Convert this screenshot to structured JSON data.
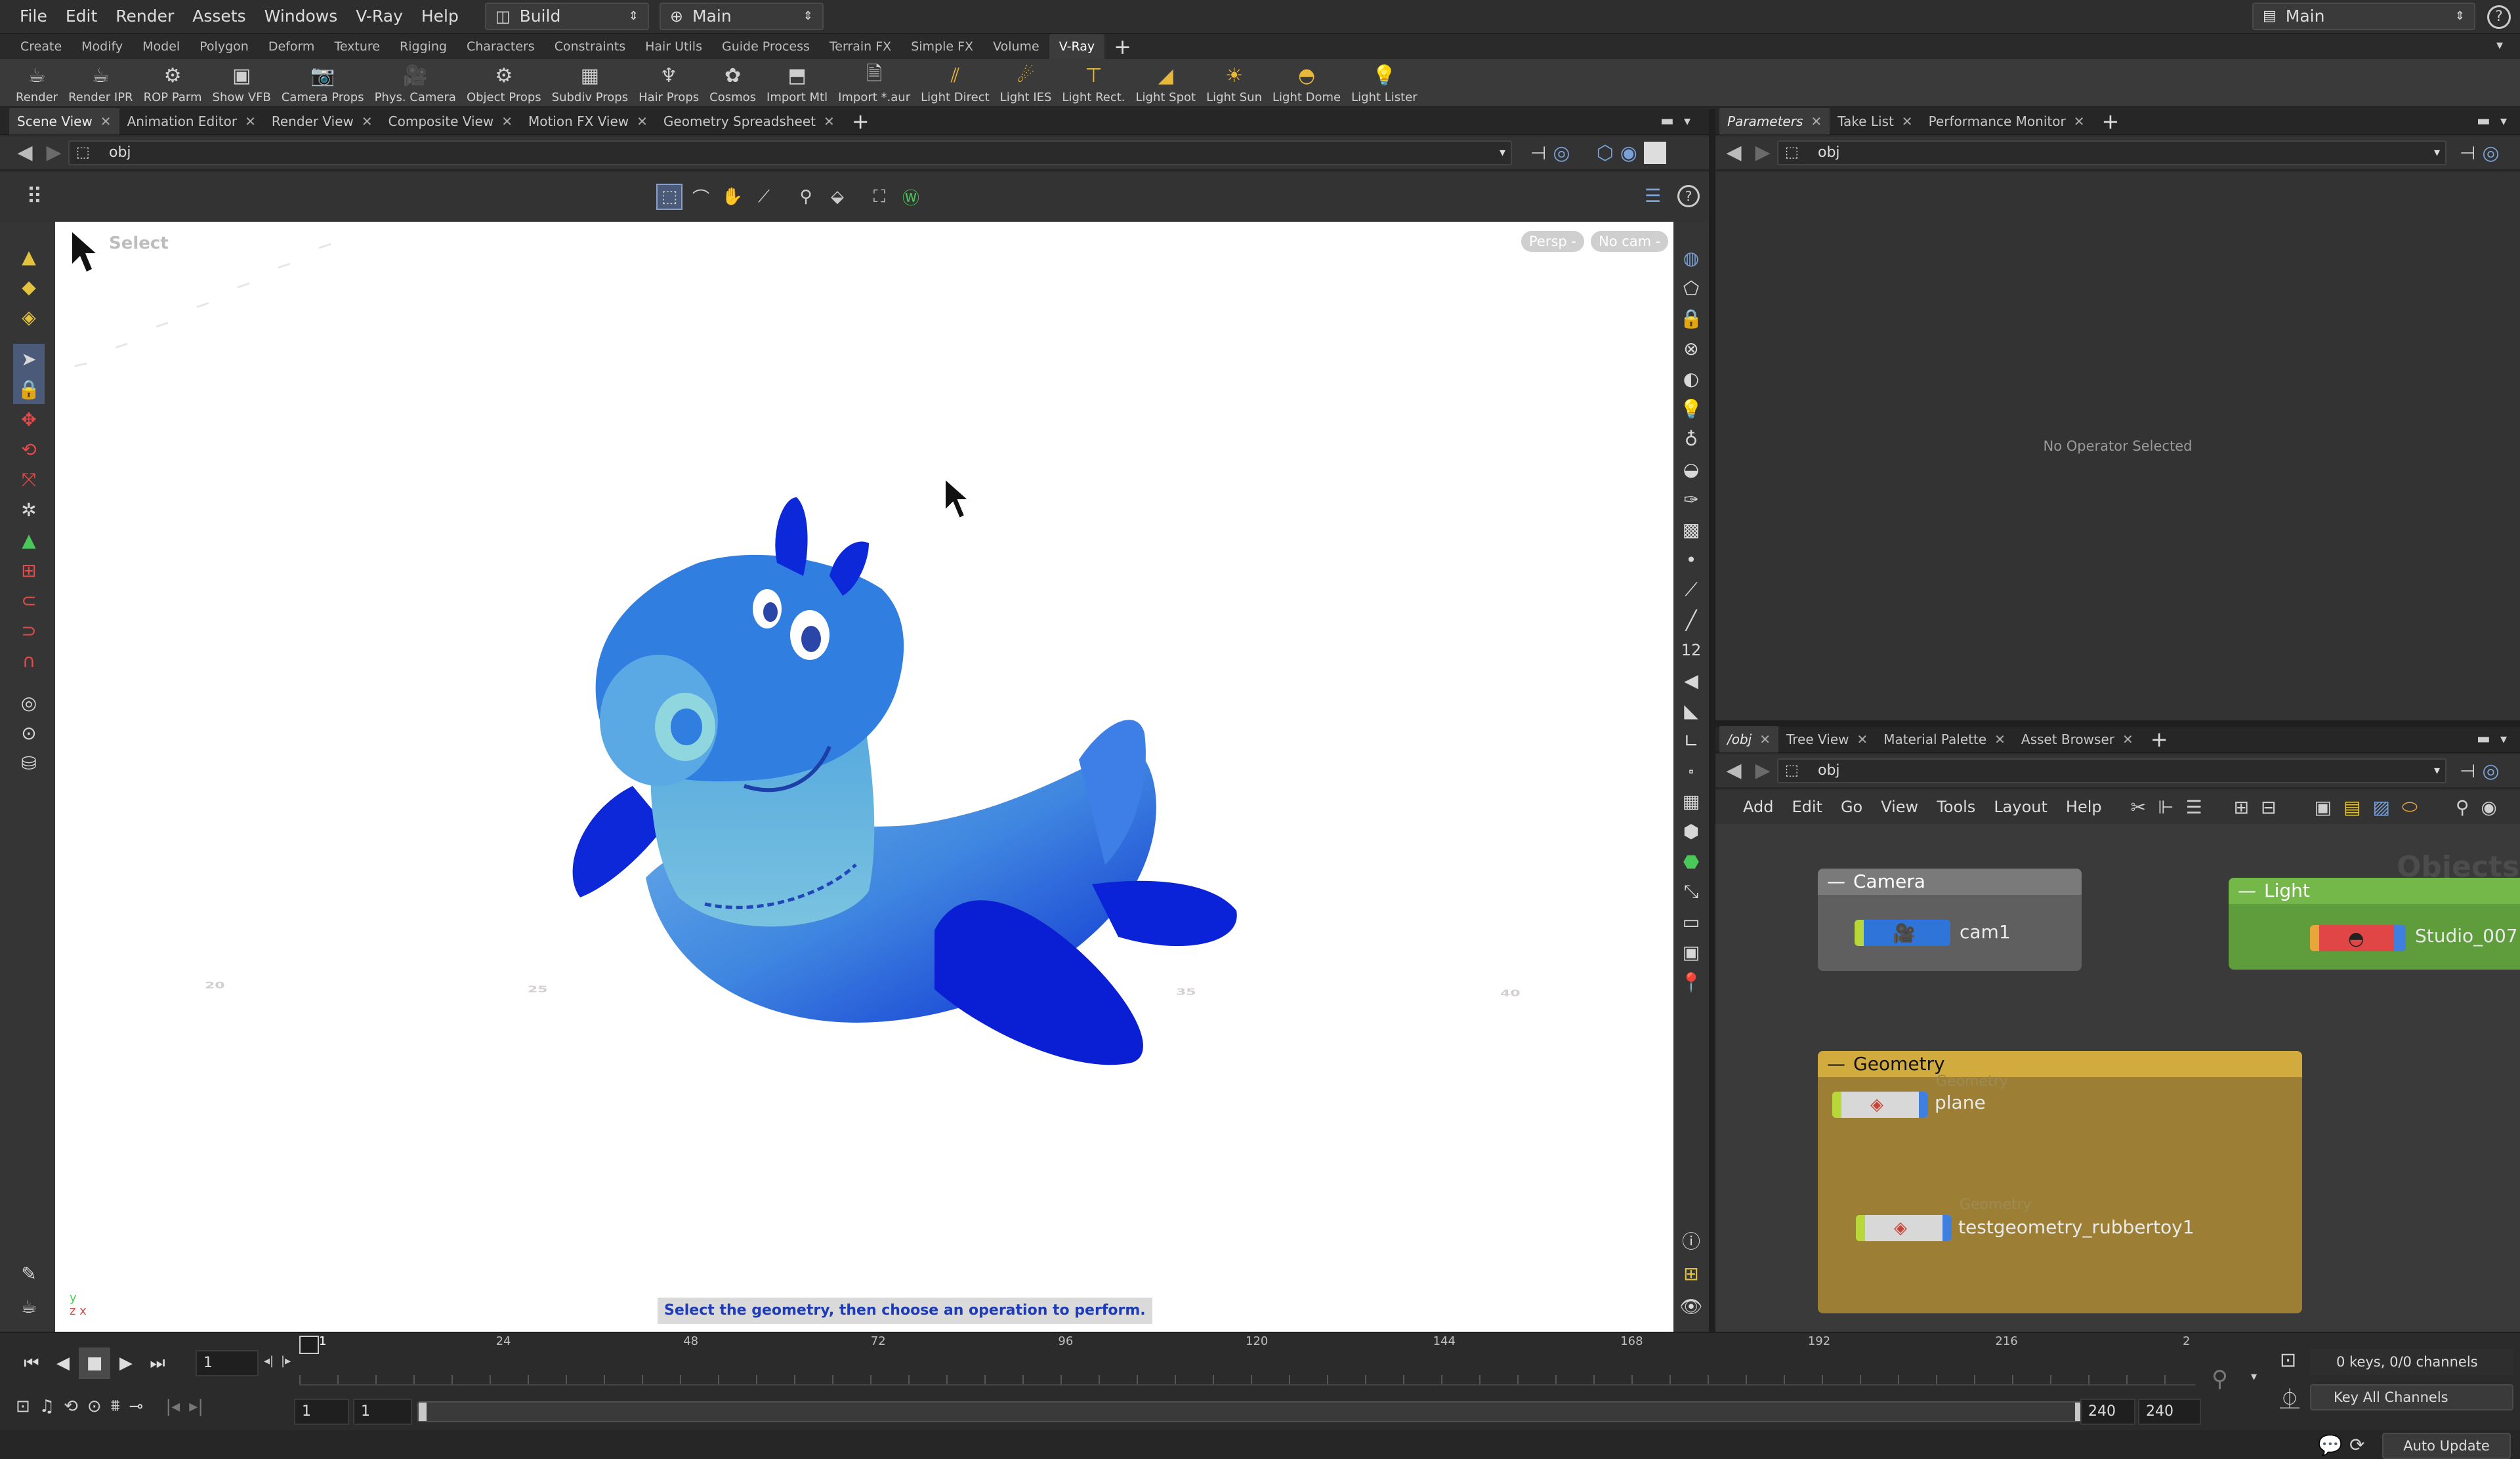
{
  "menu": [
    "File",
    "Edit",
    "Render",
    "Assets",
    "Windows",
    "V-Ray",
    "Help"
  ],
  "desktop": {
    "build_label": "Build",
    "main_label": "Main",
    "right_main_label": "Main"
  },
  "shelf_tabs": [
    "Create",
    "Modify",
    "Model",
    "Polygon",
    "Deform",
    "Texture",
    "Rigging",
    "Characters",
    "Constraints",
    "Hair Utils",
    "Guide Process",
    "Terrain FX",
    "Simple FX",
    "Volume",
    "V-Ray"
  ],
  "shelf_active": "V-Ray",
  "shelf_tools": [
    {
      "label": "Render",
      "icon": "teapot-icon",
      "glyph": "☕"
    },
    {
      "label": "Render IPR",
      "icon": "teapot-ipr-icon",
      "glyph": "☕"
    },
    {
      "label": "ROP Parm",
      "icon": "gear-icon",
      "glyph": "⚙"
    },
    {
      "label": "Show VFB",
      "icon": "frame-buffer-icon",
      "glyph": "▣"
    },
    {
      "label": "Camera Props",
      "icon": "camera-icon",
      "glyph": "📷"
    },
    {
      "label": "Phys. Camera",
      "icon": "physical-camera-icon",
      "glyph": "🎥"
    },
    {
      "label": "Object Props",
      "icon": "object-gear-icon",
      "glyph": "⚙"
    },
    {
      "label": "Subdiv Props",
      "icon": "subdiv-icon",
      "glyph": "▦"
    },
    {
      "label": "Hair Props",
      "icon": "hair-icon",
      "glyph": "♆"
    },
    {
      "label": "Cosmos",
      "icon": "cosmos-icon",
      "glyph": "✿"
    },
    {
      "label": "Import Mtl",
      "icon": "import-material-icon",
      "glyph": "⬒"
    },
    {
      "label": "Import *.aur",
      "icon": "import-aur-icon",
      "glyph": "🗎"
    },
    {
      "label": "Light Direct",
      "icon": "light-direct-icon",
      "glyph": "⫽"
    },
    {
      "label": "Light IES",
      "icon": "light-ies-icon",
      "glyph": "☄"
    },
    {
      "label": "Light Rect.",
      "icon": "light-rect-icon",
      "glyph": "⊤"
    },
    {
      "label": "Light Spot",
      "icon": "light-spot-icon",
      "glyph": "◢"
    },
    {
      "label": "Light Sun",
      "icon": "light-sun-icon",
      "glyph": "☀"
    },
    {
      "label": "Light Dome",
      "icon": "light-dome-icon",
      "glyph": "◓"
    },
    {
      "label": "Light Lister",
      "icon": "light-lister-icon",
      "glyph": "💡"
    }
  ],
  "left_tabs": [
    {
      "label": "Scene View",
      "active": true
    },
    {
      "label": "Animation Editor",
      "active": false
    },
    {
      "label": "Render View",
      "active": false
    },
    {
      "label": "Composite View",
      "active": false
    },
    {
      "label": "Motion FX View",
      "active": false
    },
    {
      "label": "Geometry Spreadsheet",
      "active": false
    }
  ],
  "path": "obj",
  "viewport": {
    "mode_label": "Select",
    "persp_label": "Persp -",
    "cam_label": "No cam -",
    "hint": "Select the geometry, then choose an operation to perform.",
    "grid_labels": [
      "20",
      "25",
      "35",
      "40"
    ],
    "axis_y": "y",
    "axis_zx": "z x",
    "model_color": "#1f5fe0"
  },
  "right_top_tabs": [
    {
      "label": "Parameters",
      "active": true
    },
    {
      "label": "Take List",
      "active": false
    },
    {
      "label": "Performance Monitor",
      "active": false
    }
  ],
  "params_empty": "No Operator Selected",
  "right_bottom_tabs": [
    {
      "label": "/obj",
      "active": true
    },
    {
      "label": "Tree View",
      "active": false
    },
    {
      "label": "Material Palette",
      "active": false
    },
    {
      "label": "Asset Browser",
      "active": false
    }
  ],
  "network_menu": [
    "Add",
    "Edit",
    "Go",
    "View",
    "Tools",
    "Layout",
    "Help"
  ],
  "network_watermark": "Objects",
  "network": {
    "camera_box": {
      "title": "Camera",
      "node": "cam1"
    },
    "light_box": {
      "title": "Light",
      "node": "Studio_007"
    },
    "geometry_box": {
      "title": "Geometry",
      "nodes": [
        {
          "type": "Geometry",
          "name": "plane"
        },
        {
          "type": "Geometry",
          "name": "testgeometry_rubbertoy1"
        }
      ]
    },
    "colors": {
      "camera": "#5f5f5f",
      "light": "#5f9c3b",
      "geometry": "#9c7f35",
      "geometry_header": "#d2ab3e"
    }
  },
  "timeline": {
    "current_frame": "1",
    "frame_ticks": [
      "1",
      "24",
      "48",
      "72",
      "96",
      "120",
      "144",
      "168",
      "192",
      "216",
      "2"
    ],
    "range_start": "1",
    "range_start2": "1",
    "range_end": "240",
    "range_end2": "240",
    "keys_label": "0 keys, 0/0 channels",
    "key_all_label": "Key All Channels",
    "auto_update": "Auto Update"
  }
}
